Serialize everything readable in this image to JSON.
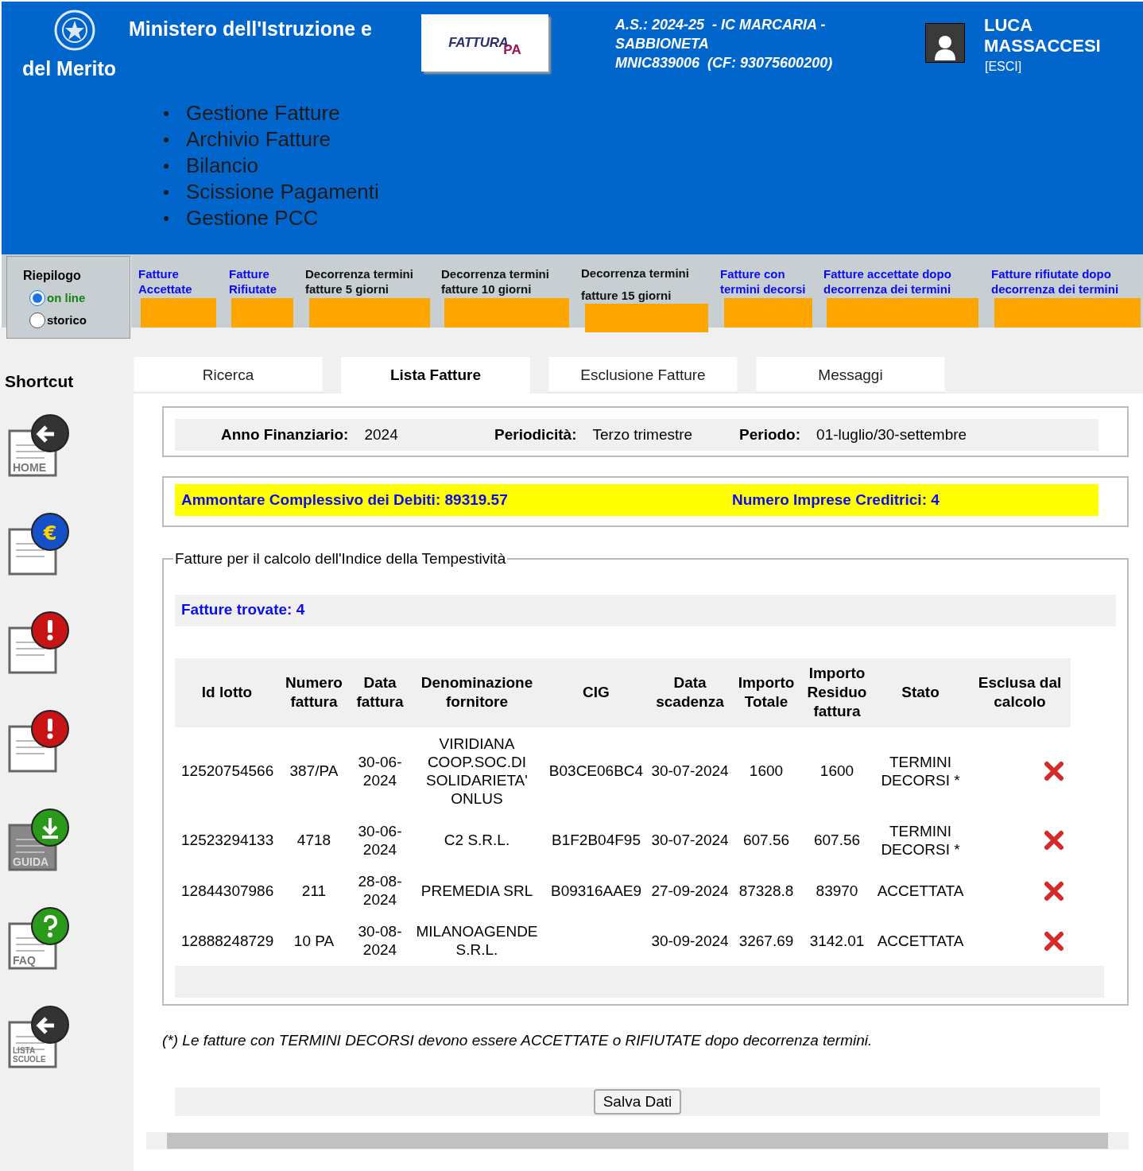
{
  "header": {
    "ministry": [
      "Ministero dell'Istruzione e",
      "del Merito"
    ],
    "logo": [
      "FATTURA",
      "PA"
    ],
    "school_info": [
      "A.S.: 2024-25  - IC MARCARIA -",
      "SABBIONETA",
      "MNIC839006  (CF: 93075600200)"
    ],
    "user_name": "LUCA MASSACCESI",
    "logout": "[ESCI]"
  },
  "nav_menu": [
    "Gestione Fatture",
    "Archivio Fatture",
    "Bilancio",
    "Scissione Pagamenti",
    "Gestione PCC"
  ],
  "summary": {
    "title": "Riepilogo",
    "options": [
      {
        "label": "on line",
        "selected": true
      },
      {
        "label": "storico",
        "selected": false
      }
    ]
  },
  "stats": [
    {
      "label": "Fatture Accettate",
      "kind": "link"
    },
    {
      "label": "Fatture Rifiutate",
      "kind": "link"
    },
    {
      "label": "Decorrenza termini fatture 5 giorni",
      "kind": "text"
    },
    {
      "label": "Decorrenza termini fatture 10 giorni",
      "kind": "text"
    },
    {
      "label": "Decorrenza termini fatture 15 giorni",
      "kind": "text"
    },
    {
      "label": "Fatture con termini decorsi",
      "kind": "link"
    },
    {
      "label": "Fatture accettate dopo decorrenza dei termini",
      "kind": "link"
    },
    {
      "label": "Fatture rifiutate dopo decorrenza dei termini",
      "kind": "link"
    }
  ],
  "shortcuts": {
    "title": "Shortcut",
    "items": [
      {
        "kind": "home",
        "label": "HOME"
      },
      {
        "kind": "euro",
        "symbol": "€"
      },
      {
        "kind": "alert"
      },
      {
        "kind": "alert"
      },
      {
        "kind": "guide",
        "label": "GUIDA"
      },
      {
        "kind": "faq",
        "label": "FAQ"
      },
      {
        "kind": "schools",
        "label": "LISTA SCUOLE"
      }
    ]
  },
  "tabs": [
    {
      "label": "Ricerca",
      "selected": false
    },
    {
      "label": "Lista Fatture",
      "selected": true
    },
    {
      "label": "Esclusione Fatture",
      "selected": false
    },
    {
      "label": "Messaggi",
      "selected": false
    }
  ],
  "filters": [
    {
      "label": "Anno Finanziario:",
      "value": "2024"
    },
    {
      "label": "Periodicità:",
      "value": "Terzo trimestre"
    },
    {
      "label": "Periodo:",
      "value": "01-luglio/30-settembre"
    }
  ],
  "totals": [
    "Ammontare Complessivo dei Debiti: 89319.57",
    "Numero Imprese Creditrici: 4"
  ],
  "invoices": {
    "legend": "Fatture per il calcolo dell'Indice della Tempestività",
    "found": "Fatture trovate: 4",
    "columns": [
      "Id lotto",
      "Numero fattura",
      "Data fattura",
      "Denominazione fornitore",
      "CIG",
      "Data scadenza",
      "Importo Totale",
      "Importo Residuo fattura",
      "Stato",
      "Esclusa dal calcolo"
    ],
    "rows": [
      [
        "12520754566",
        "387/PA",
        "30-06-2024",
        "VIRIDIANA COOP.SOC.DI SOLIDARIETA' ONLUS",
        "B03CE06BC4",
        "30-07-2024",
        "1600",
        "1600",
        "TERMINI DECORSI *"
      ],
      [
        "12523294133",
        "4718",
        "30-06-2024",
        "C2 S.R.L.",
        "B1F2B04F95",
        "30-07-2024",
        "607.56",
        "607.56",
        "TERMINI DECORSI *"
      ],
      [
        "12844307986",
        "211",
        "28-08-2024",
        "PREMEDIA SRL",
        "B09316AAE9",
        "27-09-2024",
        "87328.8",
        "83970",
        "ACCETTATA"
      ],
      [
        "12888248729",
        "10 PA",
        "30-08-2024",
        "MILANOAGENDE S.R.L.",
        "",
        "30-09-2024",
        "3267.69",
        "3142.01",
        "ACCETTATA"
      ]
    ]
  },
  "footnote": "(*) Le fatture con TERMINI DECORSI devono essere ACCETTATE o RIFIUTATE dopo decorrenza termini.",
  "save_button": "Salva Dati"
}
